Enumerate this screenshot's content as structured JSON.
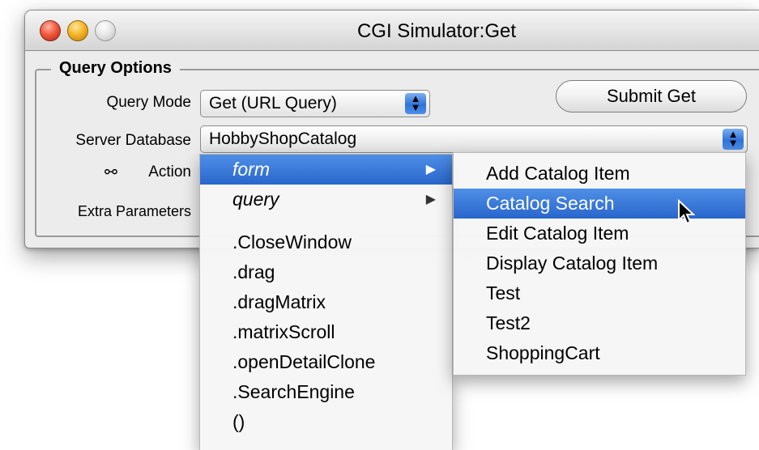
{
  "window": {
    "title": "CGI Simulator:Get"
  },
  "query_options": {
    "group_label": "Query Options",
    "query_mode_label": "Query Mode",
    "query_mode_value": "Get (URL Query)",
    "submit_label": "Submit Get",
    "server_db_label": "Server Database",
    "server_db_value": "HobbyShopCatalog",
    "action_label": "Action",
    "extra_params_label": "Extra Parameters"
  },
  "menu": {
    "items": [
      "form",
      "query"
    ],
    "procedures": [
      ".CloseWindow",
      ".drag",
      ".dragMatrix",
      ".matrixScroll",
      ".openDetailClone",
      ".SearchEngine",
      "()"
    ]
  },
  "submenu": {
    "items": [
      "Add Catalog Item",
      "Catalog Search",
      "Edit Catalog Item",
      "Display Catalog Item",
      "Test",
      "Test2",
      "ShoppingCart"
    ]
  },
  "colors": {
    "selection": "#2f6fd6",
    "window_bg": "#ececec"
  }
}
